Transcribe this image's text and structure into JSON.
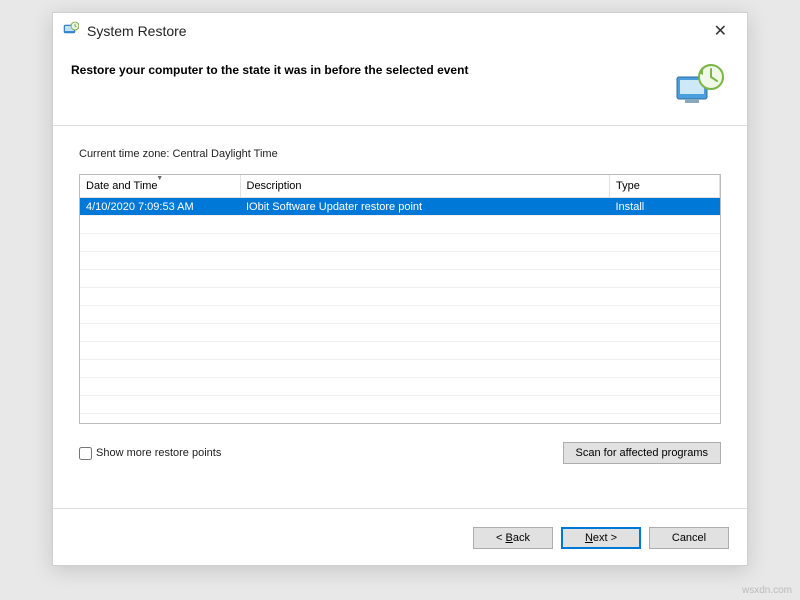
{
  "window": {
    "title": "System Restore",
    "close_icon": "✕"
  },
  "header": {
    "heading": "Restore your computer to the state it was in before the selected event"
  },
  "content": {
    "timezone_label": "Current time zone: Central Daylight Time",
    "columns": {
      "date": "Date and Time",
      "description": "Description",
      "type": "Type"
    },
    "rows": [
      {
        "date": "4/10/2020 7:09:53 AM",
        "description": "IObit Software Updater restore point",
        "type": "Install"
      }
    ],
    "show_more_label": "Show more restore points",
    "scan_button": "Scan for affected programs"
  },
  "footer": {
    "back": "< Back",
    "next": "Next >",
    "cancel": "Cancel"
  },
  "watermark": "wsxdn.com"
}
